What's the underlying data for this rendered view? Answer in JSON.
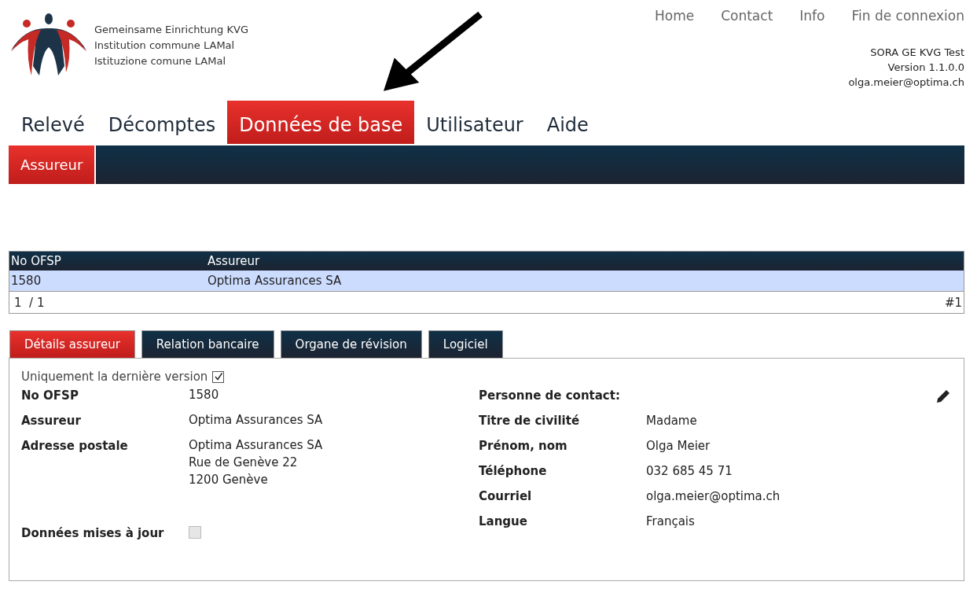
{
  "header": {
    "logo_lines": [
      "Gemeinsame Einrichtung KVG",
      "Institution commune LAMal",
      "Istituzione comune LAMal"
    ],
    "top_links": [
      "Home",
      "Contact",
      "Info",
      "Fin de connexion"
    ],
    "app_info": [
      "SORA GE KVG Test",
      "Version 1.1.0.0",
      "olga.meier@optima.ch"
    ]
  },
  "main_tabs": [
    {
      "label": "Relevé",
      "selected": false
    },
    {
      "label": "Décomptes",
      "selected": false
    },
    {
      "label": "Données de base",
      "selected": true
    },
    {
      "label": "Utilisateur",
      "selected": false
    },
    {
      "label": "Aide",
      "selected": false
    }
  ],
  "sub_tabs": [
    {
      "label": "Assureur",
      "selected": true
    }
  ],
  "table": {
    "columns": [
      "No OFSP",
      "Assureur"
    ],
    "rows": [
      {
        "cells": [
          "1580",
          "Optima Assurances SA"
        ],
        "selected": true
      }
    ],
    "pager": "1  / 1",
    "count": "#1"
  },
  "detail_tabs": [
    {
      "label": "Détails assureur",
      "selected": true
    },
    {
      "label": "Relation bancaire",
      "selected": false
    },
    {
      "label": "Organe de révision",
      "selected": false
    },
    {
      "label": "Logiciel",
      "selected": false
    }
  ],
  "details": {
    "filter": {
      "label": "Uniquement la dernière version",
      "checked": true
    },
    "fields": [
      {
        "label": "No OFSP",
        "lines": [
          "1580"
        ]
      },
      {
        "label": "Assureur",
        "lines": [
          "Optima Assurances SA"
        ]
      },
      {
        "label": "Adresse postale",
        "lines": [
          "Optima Assurances SA",
          "Rue de Genève 22",
          "1200 Genève"
        ]
      }
    ],
    "updated": {
      "label": "Données mises à jour",
      "checked": false
    },
    "contact_title": "Personne de contact:",
    "contact_fields": [
      {
        "label": "Titre de civilité",
        "value": "Madame"
      },
      {
        "label": "Prénom, nom",
        "value": "Olga Meier"
      },
      {
        "label": "Téléphone",
        "value": "032 685 45 71"
      },
      {
        "label": "Courriel",
        "value": "olga.meier@optima.ch"
      },
      {
        "label": "Langue",
        "value": "Français"
      }
    ]
  }
}
